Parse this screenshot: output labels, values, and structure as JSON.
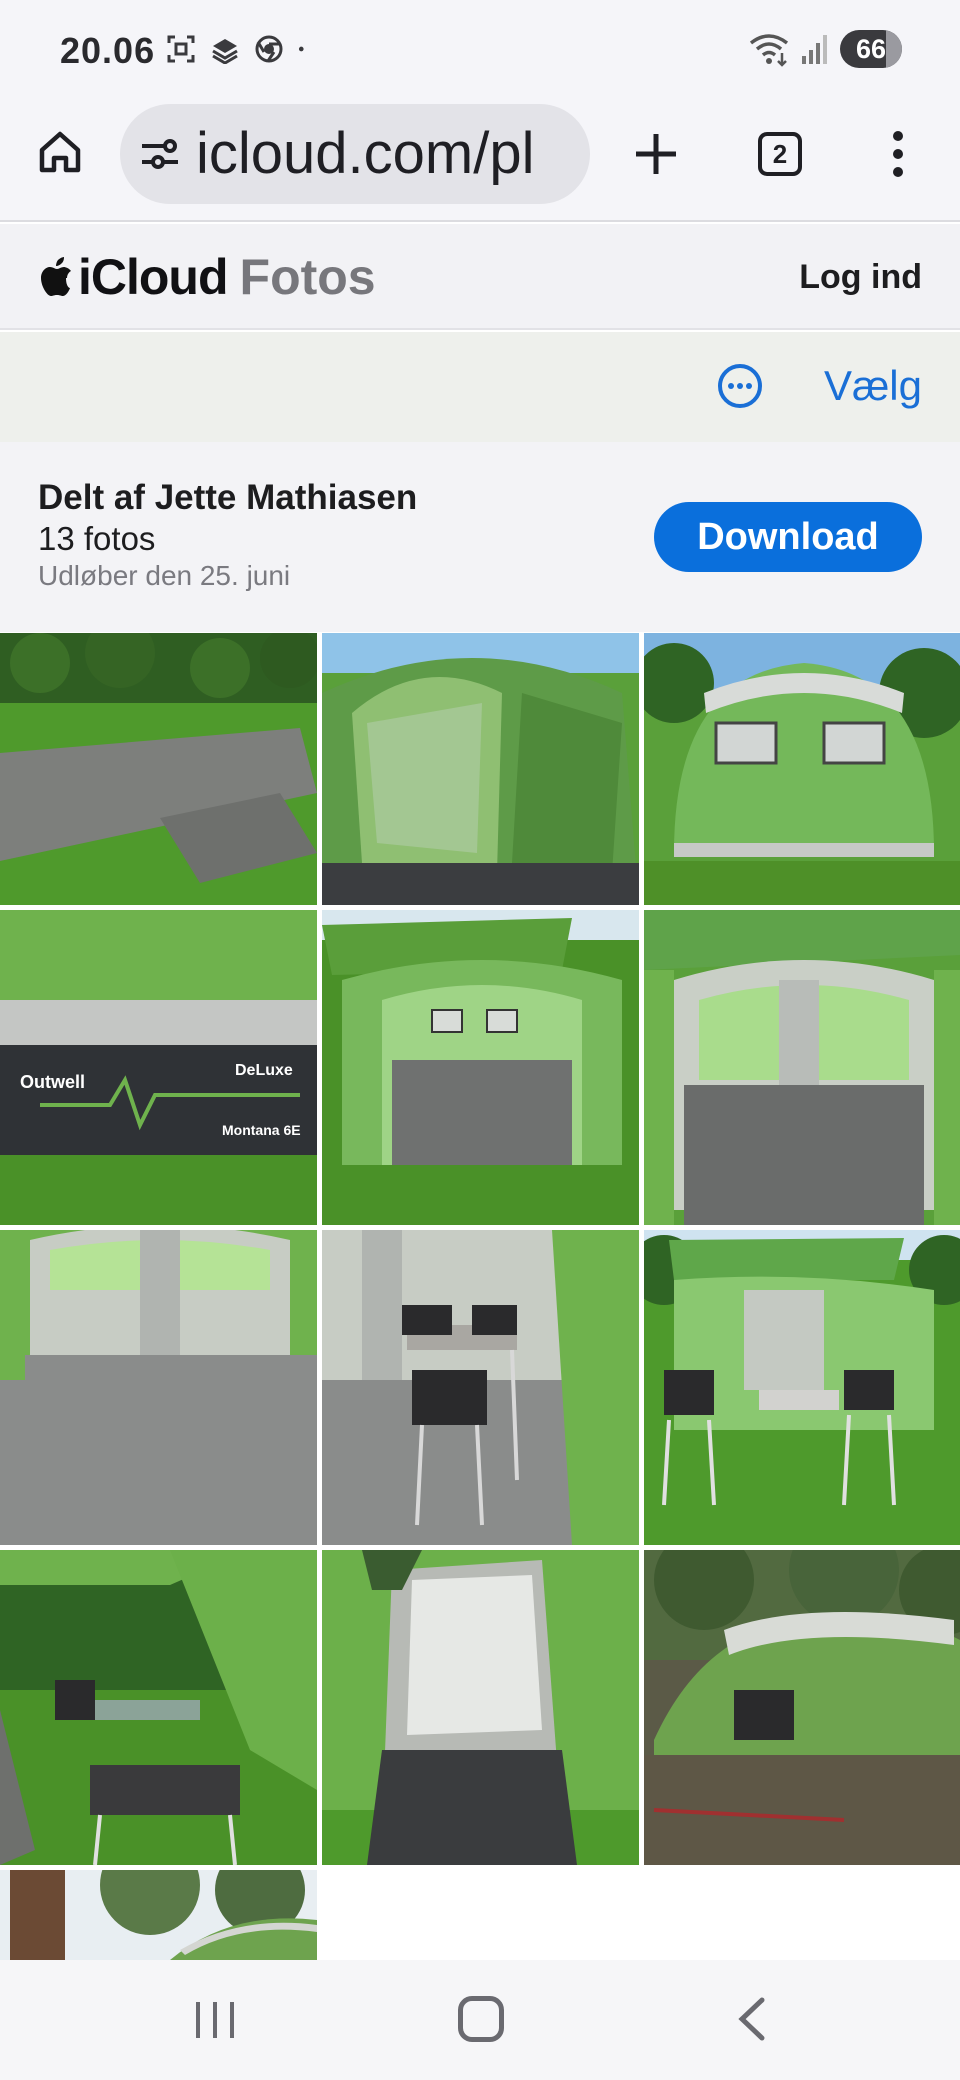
{
  "status_bar": {
    "time": "20.06",
    "battery": "66",
    "icons": [
      "screenshot-icon",
      "stack-icon",
      "chrome-icon",
      "dot-icon",
      "wifi-icon",
      "signal-icon",
      "battery-icon"
    ]
  },
  "browser": {
    "url": "icloud.com/pl",
    "tab_count": "2",
    "icons": [
      "home-icon",
      "site-settings-icon",
      "new-tab-icon",
      "tabs-icon",
      "menu-icon"
    ]
  },
  "header": {
    "brand_main": "iCloud",
    "brand_sub": "Fotos",
    "login_label": "Log ind"
  },
  "action_bar": {
    "select_label": "Vælg"
  },
  "album": {
    "shared_by": "Delt af Jette Mathiasen",
    "photo_count": "13 fotos",
    "expires": "Udløber den 25. juni",
    "download_label": "Download"
  },
  "photos": [
    {
      "name": "photo-groundsheet-on-lawn"
    },
    {
      "name": "photo-tent-side-window"
    },
    {
      "name": "photo-tent-front-windows"
    },
    {
      "name": "photo-outwell-montana-6e-label"
    },
    {
      "name": "photo-tent-front-open"
    },
    {
      "name": "photo-tent-interior-1"
    },
    {
      "name": "photo-tent-interior-2"
    },
    {
      "name": "photo-tent-interior-with-table"
    },
    {
      "name": "photo-tent-canopy-with-chairs"
    },
    {
      "name": "photo-tent-side-awning"
    },
    {
      "name": "photo-tent-entrance"
    },
    {
      "name": "photo-tent-in-forest"
    },
    {
      "name": "photo-forest-tent-partial"
    }
  ],
  "photo_labels": {
    "brand": "Outwell",
    "collection": "DeLuxe",
    "model": "Montana 6E"
  },
  "nav": {
    "icons": [
      "recent-apps-icon",
      "home-button-icon",
      "back-icon"
    ]
  },
  "colors": {
    "accent": "#0a6fdc",
    "tent_green": "#6cb04a",
    "grass_green": "#4f9a2c"
  }
}
